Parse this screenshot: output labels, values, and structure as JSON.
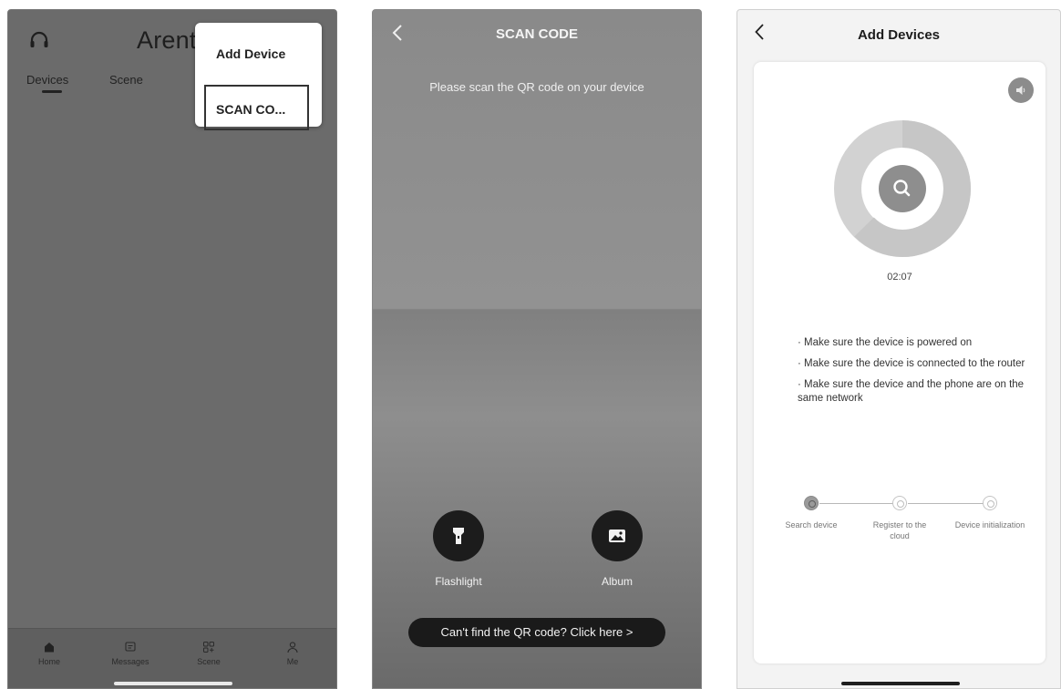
{
  "screen1": {
    "app_title": "Arent",
    "tabs": [
      {
        "label": "Devices"
      },
      {
        "label": "Scene"
      }
    ],
    "popup": {
      "add_device": "Add Device",
      "scan_code": "SCAN CO..."
    },
    "nav": [
      {
        "label": "Home",
        "icon": "home-icon"
      },
      {
        "label": "Messages",
        "icon": "messages-icon"
      },
      {
        "label": "Scene",
        "icon": "scene-icon"
      },
      {
        "label": "Me",
        "icon": "me-icon"
      }
    ],
    "colors": {
      "overlay": "#6b6b6b",
      "popup": "#ffffff"
    }
  },
  "screen2": {
    "title": "SCAN CODE",
    "hint": "Please scan the QR code on your device",
    "flashlight_label": "Flashlight",
    "album_label": "Album",
    "cant_find": "Can't find the QR code? Click here  >"
  },
  "screen3": {
    "title": "Add Devices",
    "timer": "02:07",
    "tips": [
      "· Make sure the device is powered on",
      "· Make sure the device is connected to the router",
      "· Make sure the device and the phone are on the same network"
    ],
    "steps": [
      {
        "label": "Search device",
        "active": true
      },
      {
        "label": "Register to the cloud",
        "active": false
      },
      {
        "label": "Device initialization",
        "active": false
      }
    ]
  }
}
